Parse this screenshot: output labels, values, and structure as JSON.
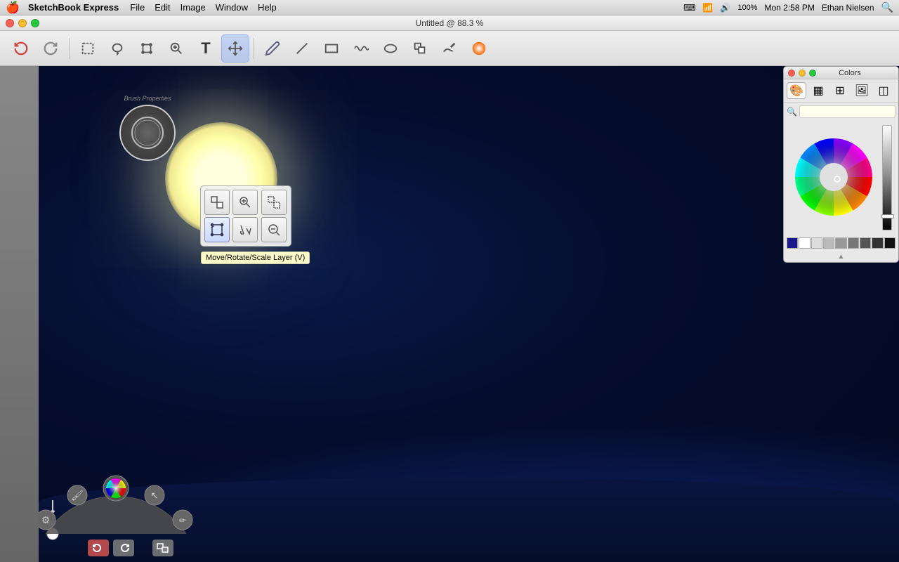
{
  "menubar": {
    "apple": "🍎",
    "appname": "SketchBook Express",
    "items": [
      "File",
      "Edit",
      "Image",
      "Window",
      "Help"
    ],
    "right": {
      "time": "Mon 2:58 PM",
      "user": "Ethan Nielsen",
      "battery": "100%"
    }
  },
  "titlebar": {
    "title": "Untitled @ 88.3 %"
  },
  "toolbar": {
    "tools": [
      {
        "name": "undo",
        "label": "↩",
        "tooltip": "Undo"
      },
      {
        "name": "redo",
        "label": "↪",
        "tooltip": "Redo"
      },
      {
        "name": "select-rect",
        "label": "▭",
        "tooltip": "Rectangle Select"
      },
      {
        "name": "select-lasso",
        "label": "⬡",
        "tooltip": "Lasso Select"
      },
      {
        "name": "transform",
        "label": "⊹",
        "tooltip": "Transform"
      },
      {
        "name": "zoom",
        "label": "🔍",
        "tooltip": "Zoom"
      },
      {
        "name": "text",
        "label": "T",
        "tooltip": "Text"
      },
      {
        "name": "move",
        "label": "✛",
        "tooltip": "Move"
      },
      {
        "name": "pencil",
        "label": "✏",
        "tooltip": "Pencil"
      },
      {
        "name": "line",
        "label": "╱",
        "tooltip": "Line"
      },
      {
        "name": "rect-shape",
        "label": "□",
        "tooltip": "Rectangle"
      },
      {
        "name": "wave",
        "label": "∿",
        "tooltip": "Wave"
      },
      {
        "name": "ellipse",
        "label": "○",
        "tooltip": "Ellipse"
      },
      {
        "name": "layers",
        "label": "⧉",
        "tooltip": "Layers"
      },
      {
        "name": "brush-tool",
        "label": "✒",
        "tooltip": "Brush"
      },
      {
        "name": "color-picker",
        "label": "🎨",
        "tooltip": "Color Picker"
      }
    ]
  },
  "colors_panel": {
    "title": "Colors",
    "tabs": [
      "🎨",
      "▦",
      "⊞",
      "🖼",
      "◫"
    ],
    "search_placeholder": "",
    "swatches": [
      "#1a1a8c",
      "#ffffff",
      "#dddddd",
      "#bbbbbb",
      "#999999",
      "#777777",
      "#555555",
      "#333333",
      "#111111"
    ]
  },
  "popup": {
    "tooltip": "Move/Rotate/Scale Layer (V)",
    "tools": [
      {
        "icon": "⊡",
        "active": false
      },
      {
        "icon": "🔍",
        "active": false
      },
      {
        "icon": "⊡",
        "active": false
      },
      {
        "icon": "⊡",
        "active": true
      },
      {
        "icon": "↙",
        "active": false
      },
      {
        "icon": "🔍",
        "active": false
      }
    ]
  },
  "brush_properties": {
    "label": "Brush Properties"
  }
}
